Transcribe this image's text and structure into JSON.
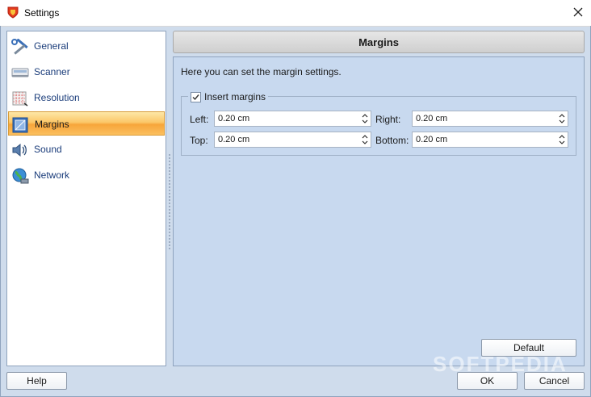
{
  "window": {
    "title": "Settings",
    "close_icon": "close-icon"
  },
  "sidebar": {
    "items": [
      {
        "label": "General",
        "icon": "tools-icon"
      },
      {
        "label": "Scanner",
        "icon": "scanner-icon"
      },
      {
        "label": "Resolution",
        "icon": "resolution-grid-icon"
      },
      {
        "label": "Margins",
        "icon": "margins-icon",
        "selected": true
      },
      {
        "label": "Sound",
        "icon": "speaker-icon"
      },
      {
        "label": "Network",
        "icon": "network-globe-icon"
      }
    ]
  },
  "panel": {
    "title": "Margins",
    "description": "Here you can set the margin settings.",
    "group": {
      "label": "Insert margins",
      "checked": true,
      "fields": {
        "left": {
          "label": "Left:",
          "value": "0.20 cm"
        },
        "right": {
          "label": "Right:",
          "value": "0.20 cm"
        },
        "top": {
          "label": "Top:",
          "value": "0.20 cm"
        },
        "bottom": {
          "label": "Bottom:",
          "value": "0.20 cm"
        }
      }
    },
    "default_label": "Default"
  },
  "footer": {
    "help_label": "Help",
    "ok_label": "OK",
    "cancel_label": "Cancel"
  },
  "watermark": "SOFTPEDIA",
  "colors": {
    "accent_selected": "#f7a53a",
    "panel_bg": "#c8d9ef",
    "window_bg": "#cfdcec"
  }
}
